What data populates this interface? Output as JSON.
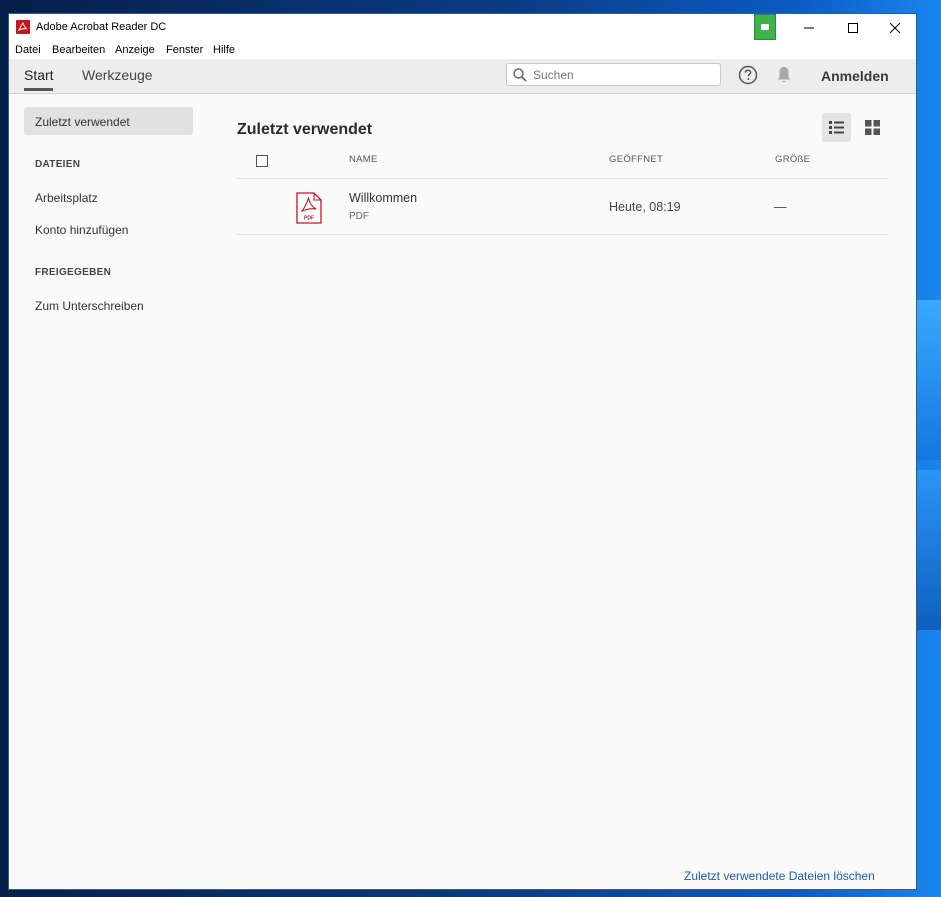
{
  "window": {
    "title": "Adobe Acrobat Reader DC"
  },
  "menu": [
    "Datei",
    "Bearbeiten",
    "Anzeige",
    "Fenster",
    "Hilfe"
  ],
  "toolbar": {
    "tab_start": "Start",
    "tab_tools": "Werkzeuge",
    "search_placeholder": "Suchen",
    "signin": "Anmelden"
  },
  "sidebar": {
    "active_item": "Zuletzt verwendet",
    "section_files": "DATEIEN",
    "item_workspace": "Arbeitsplatz",
    "item_add_account": "Konto hinzufügen",
    "section_shared": "FREIGEGEBEN",
    "item_to_sign": "Zum Unterschreiben"
  },
  "main": {
    "title": "Zuletzt verwendet",
    "columns": {
      "name": "NAME",
      "opened": "GEÖFFNET",
      "size": "GRÖßE"
    },
    "files": [
      {
        "name": "Willkommen",
        "type": "PDF",
        "opened": "Heute, 08:19",
        "size": "—"
      }
    ],
    "clear_link": "Zuletzt verwendete Dateien löschen"
  },
  "colors": {
    "accent_red": "#c4161c",
    "link_blue": "#1a5fa8",
    "indicator_green": "#3cb44a"
  },
  "icons": [
    "acrobat-icon",
    "search-icon",
    "help-icon",
    "bell-icon",
    "list-view-icon",
    "grid-view-icon",
    "pdf-file-icon"
  ]
}
